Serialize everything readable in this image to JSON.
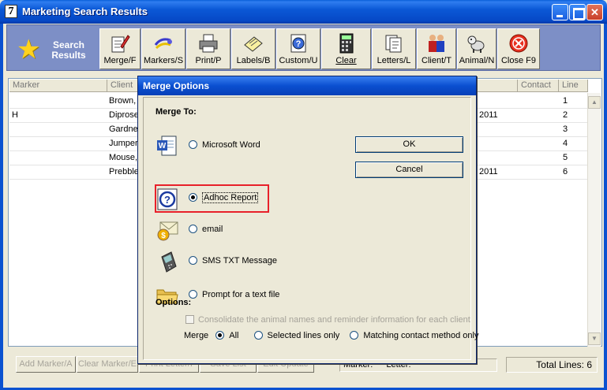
{
  "window": {
    "app_icon": "7",
    "title": "Marketing Search Results"
  },
  "toolbar": {
    "search_results_line1": "Search",
    "search_results_line2": "Results",
    "buttons": [
      {
        "label": "Merge/F",
        "icon": "merge-icon"
      },
      {
        "label": "Markers/S",
        "icon": "markers-icon"
      },
      {
        "label": "Print/P",
        "icon": "printer-icon"
      },
      {
        "label": "Labels/B",
        "icon": "labels-icon"
      },
      {
        "label": "Custom/U",
        "icon": "custom-report-icon"
      },
      {
        "label": "Clear",
        "icon": "calculator-icon"
      },
      {
        "label": "Letters/L",
        "icon": "letters-icon"
      },
      {
        "label": "Client/T",
        "icon": "client-icon"
      },
      {
        "label": "Animal/N",
        "icon": "dog-icon"
      },
      {
        "label": "Close F9",
        "icon": "close-icon"
      }
    ]
  },
  "grid": {
    "columns": [
      "Marker",
      "Client",
      "Contact",
      "Line"
    ],
    "rows": [
      {
        "marker": "",
        "client": "Brown,",
        "contact_date": "",
        "line": "1"
      },
      {
        "marker": "H",
        "client": "Diprose",
        "contact_date": "2011",
        "line": "2"
      },
      {
        "marker": "",
        "client": "Gardne",
        "contact_date": "",
        "line": "3"
      },
      {
        "marker": "",
        "client": "Jumper",
        "contact_date": "",
        "line": "4"
      },
      {
        "marker": "",
        "client": "Mouse,",
        "contact_date": "",
        "line": "5"
      },
      {
        "marker": "",
        "client": "Prebble",
        "contact_date": "2011",
        "line": "6"
      }
    ]
  },
  "bottom": {
    "buttons": [
      "Add Marker/A",
      "Clear Marker/E",
      "Print Letter/I",
      "Save List",
      "Edit Update"
    ],
    "marker_label": "Marker:",
    "letter_label": "Letter:",
    "total_lines": "Total Lines: 6"
  },
  "dialog": {
    "title": "Merge Options",
    "merge_to_label": "Merge To:",
    "options": [
      {
        "label": "Microsoft Word",
        "icon": "word-icon",
        "selected": false
      },
      {
        "label": "Adhoc Report",
        "icon": "adhoc-report-icon",
        "selected": true
      },
      {
        "label": "email",
        "icon": "email-icon",
        "selected": false
      },
      {
        "label": "SMS TXT Message",
        "icon": "mobile-phone-icon",
        "selected": false
      },
      {
        "label": "Prompt for a text file",
        "icon": "folder-icon",
        "selected": false
      }
    ],
    "ok_label": "OK",
    "cancel_label": "Cancel",
    "options_label": "Options:",
    "consolidate_label": "Consolidate the animal names and reminder information for each client",
    "merge_label": "Merge",
    "merge_modes": [
      {
        "label": "All",
        "selected": true
      },
      {
        "label": "Selected lines only",
        "selected": false
      },
      {
        "label": "Matching contact method only",
        "selected": false
      }
    ],
    "highlight_color": "#e8202a"
  }
}
